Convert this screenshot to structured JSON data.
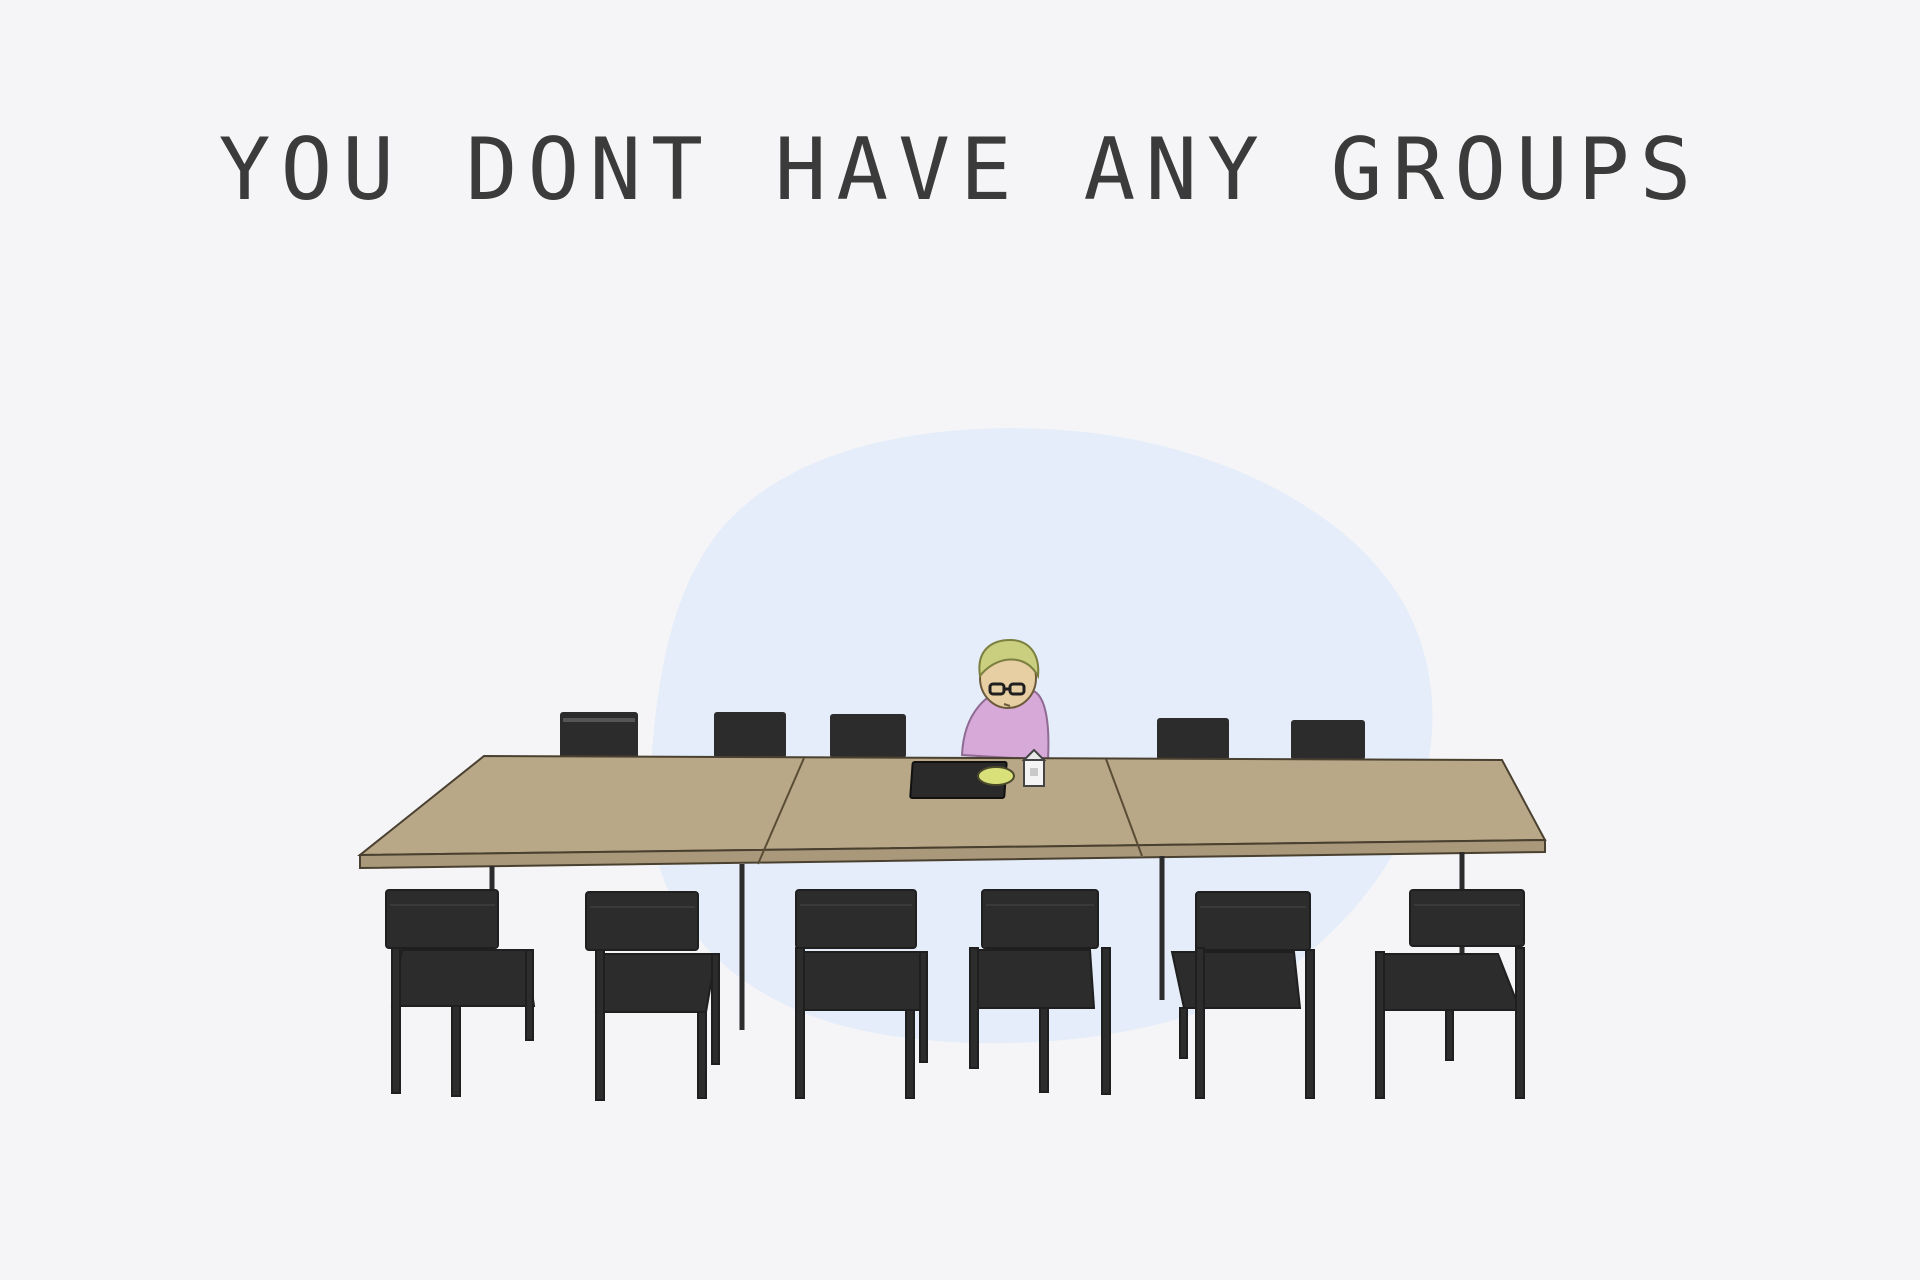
{
  "empty_state": {
    "message": "YOU DONT HAVE ANY GROUPS"
  },
  "illustration": {
    "icon": "empty-cafeteria-table-illustration",
    "colors": {
      "background": "#f5f5f7",
      "spotlight": "#e2ecf8",
      "table_top": "#b9a887",
      "table_edge": "#a9987a",
      "chair": "#2c2c2c",
      "shirt": "#d6a9d8",
      "hair": "#c9cf7e",
      "skin": "#e8cfa3"
    }
  }
}
